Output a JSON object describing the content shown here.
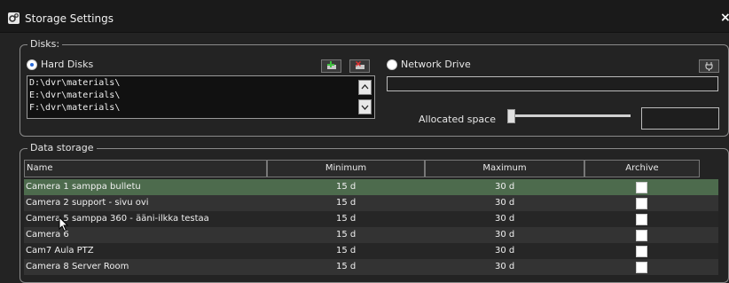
{
  "window": {
    "title": "Storage Settings",
    "close_glyph": "×"
  },
  "disks": {
    "legend": "Disks:",
    "hard_disks_label": "Hard Disks",
    "hard_disks_selected": true,
    "network_drive_label": "Network Drive",
    "network_drive_selected": false,
    "paths": [
      "D:\\dvr\\materials\\",
      "E:\\dvr\\materials\\",
      "F:\\dvr\\materials\\"
    ],
    "allocated_space_label": "Allocated space",
    "network_path_value": "",
    "allocated_space_value": ""
  },
  "data_storage": {
    "legend": "Data storage",
    "columns": [
      "Name",
      "Minimum",
      "Maximum",
      "Archive"
    ],
    "rows": [
      {
        "name": "Camera 1 samppa bulletu",
        "min": "15 d",
        "max": "30 d",
        "archive": false,
        "selected": true
      },
      {
        "name": "Camera 2 support - sivu ovi",
        "min": "15 d",
        "max": "30 d",
        "archive": false,
        "selected": false
      },
      {
        "name": "Camera 5 samppa 360 - ääni-ilkka testaa",
        "min": "15 d",
        "max": "30 d",
        "archive": false,
        "selected": false
      },
      {
        "name": "Camera 6",
        "min": "15 d",
        "max": "30 d",
        "archive": false,
        "selected": false
      },
      {
        "name": "Cam7 Aula PTZ",
        "min": "15 d",
        "max": "30 d",
        "archive": false,
        "selected": false
      },
      {
        "name": "Camera 8 Server Room",
        "min": "15 d",
        "max": "30 d",
        "archive": false,
        "selected": false
      }
    ]
  },
  "colors": {
    "selected_row": "#4d6b4d",
    "row_dark": "#262626",
    "row_alt": "#333333",
    "accent_radio": "#2a6ad8"
  }
}
